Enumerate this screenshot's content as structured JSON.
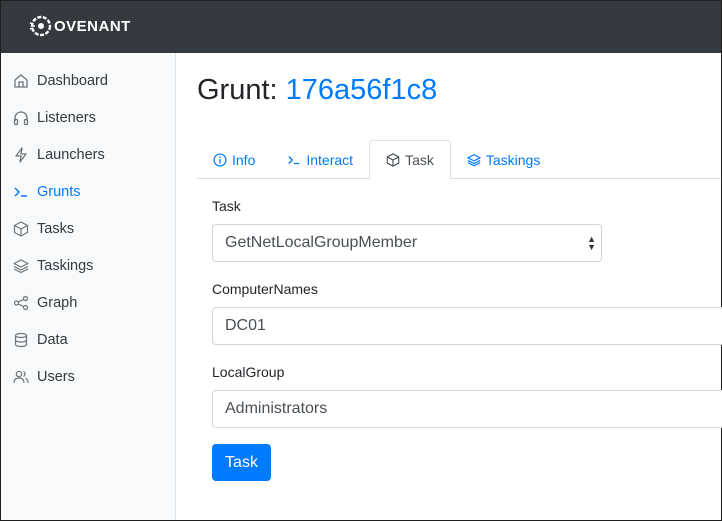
{
  "app": {
    "logo_text": "OVENANT",
    "colors": {
      "accent": "#007bff",
      "topbar": "#343a40",
      "sidebar": "#f8f9fa"
    }
  },
  "sidebar": {
    "items": [
      {
        "label": "Dashboard",
        "icon": "home-icon",
        "active": false
      },
      {
        "label": "Listeners",
        "icon": "headphones-icon",
        "active": false
      },
      {
        "label": "Launchers",
        "icon": "lightning-icon",
        "active": false
      },
      {
        "label": "Grunts",
        "icon": "terminal-icon",
        "active": true
      },
      {
        "label": "Tasks",
        "icon": "box-icon",
        "active": false
      },
      {
        "label": "Taskings",
        "icon": "layers-icon",
        "active": false
      },
      {
        "label": "Graph",
        "icon": "share-icon",
        "active": false
      },
      {
        "label": "Data",
        "icon": "database-icon",
        "active": false
      },
      {
        "label": "Users",
        "icon": "users-icon",
        "active": false
      }
    ]
  },
  "page": {
    "title_prefix": "Grunt:",
    "grunt_id": "176a56f1c8"
  },
  "tabs": [
    {
      "label": "Info",
      "icon": "info-icon",
      "active": false
    },
    {
      "label": "Interact",
      "icon": "terminal-icon",
      "active": false
    },
    {
      "label": "Task",
      "icon": "box-icon",
      "active": true
    },
    {
      "label": "Taskings",
      "icon": "layers-icon",
      "active": false
    }
  ],
  "form": {
    "task_label": "Task",
    "task_value": "GetNetLocalGroupMember",
    "computer_names_label": "ComputerNames",
    "computer_names_value": "DC01",
    "local_group_label": "LocalGroup",
    "local_group_value": "Administrators",
    "submit_label": "Task"
  }
}
